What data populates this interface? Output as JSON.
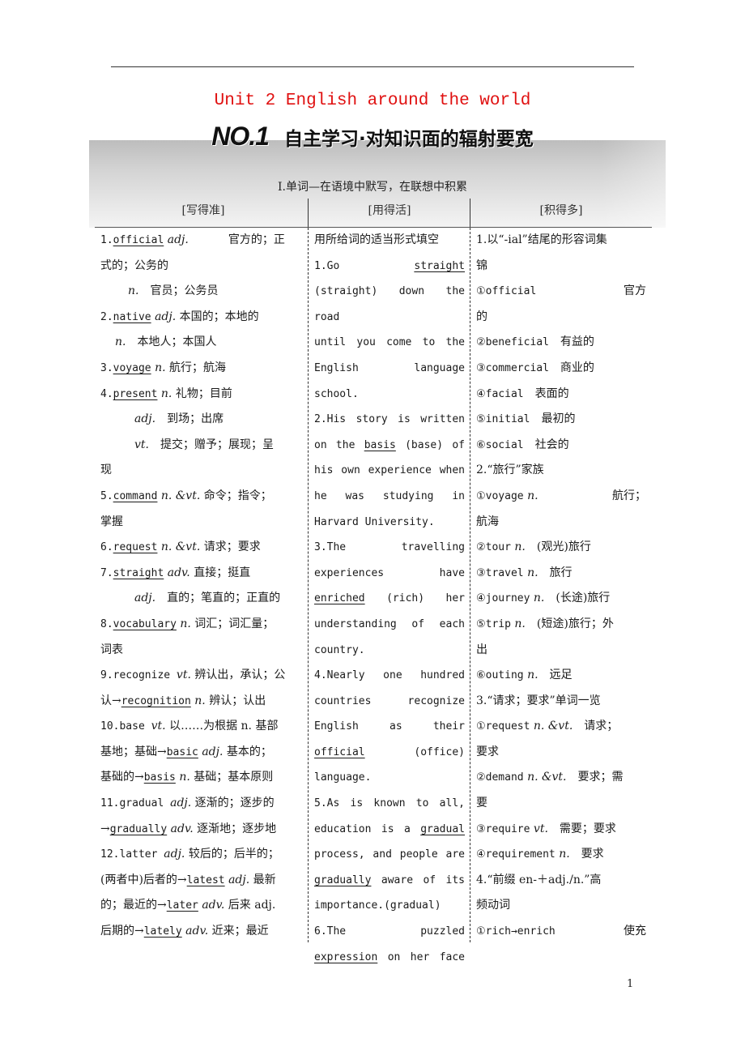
{
  "page": {
    "unit_title": "Unit 2  English around the world",
    "section_no": "NO.1",
    "section_title": "自主学习·对知识面的辐射要宽",
    "subheading": "Ⅰ.单词—在语境中默写，在联想中积累",
    "columns": [
      "[写得准]",
      "[用得活]",
      "[积得多]"
    ],
    "page_number": "1"
  },
  "left": [
    {
      "pre": "1.",
      "word": "official",
      "rest": "adj.",
      "tail": "官方的；正"
    },
    {
      "text": "式的；公务的"
    },
    {
      "pos": "n.",
      "tail": "官员；公务员"
    },
    {
      "pre": "2.",
      "word": "native",
      "rest": "adj.",
      "tail": "本国的；本地的"
    },
    {
      "pos": "n.",
      "tail": "本地人；本国人"
    },
    {
      "pre": "3.",
      "word": "voyage",
      "rest": "n.",
      "tail": "航行；航海"
    },
    {
      "pre": "4.",
      "word": "present",
      "rest": "n.",
      "tail": "礼物；目前"
    },
    {
      "pos": "adj.",
      "tail": "到场；出席"
    },
    {
      "pos": "vt.",
      "tail": "提交；赠予；展现；呈"
    },
    {
      "text": "现"
    },
    {
      "pre": "5.",
      "word": "command",
      "rest": "n. &vt.",
      "tail": "命令；指令；"
    },
    {
      "text": "掌握"
    },
    {
      "pre": "6.",
      "word": "request",
      "rest": "n. &vt.",
      "tail": "请求；要求"
    },
    {
      "pre": "7.",
      "word": "straight",
      "rest": "adv.",
      "tail": "直接；挺直"
    },
    {
      "pos": "adj.",
      "tail": "直的；笔直的；正直的"
    },
    {
      "pre": "8.",
      "word": "vocabulary",
      "rest": "n.",
      "tail": "词汇；词汇量；"
    },
    {
      "text": "词表"
    },
    {
      "pre": "9.recognize ",
      "rest": "vt.",
      "tail": "辨认出，承认；公"
    },
    {
      "lead": "认→",
      "word": "recognition",
      "rest": "n.",
      "tail": "辨认；认出"
    },
    {
      "pre": "10.base ",
      "rest": "vt.",
      "tail": "以……为根据 n. 基部"
    },
    {
      "lead": "基地；基础→",
      "word": "basic",
      "rest": "adj.",
      "tail": "基本的；"
    },
    {
      "lead": "基础的→",
      "word": "basis",
      "rest": "n.",
      "tail": "基础；基本原则"
    },
    {
      "pre": "11.gradual ",
      "rest": "adj.",
      "tail": "逐渐的；逐步的"
    },
    {
      "lead": "→",
      "word": "gradually",
      "rest": "adv.",
      "tail": "逐渐地；逐步地"
    },
    {
      "pre": "12.latter ",
      "rest": "adj.",
      "tail": "较后的；后半的；"
    },
    {
      "lead": "(两者中)后者的→",
      "word": "latest",
      "rest": "adj.",
      "tail": "最新"
    },
    {
      "lead": "的；最近的→",
      "word": "later",
      "rest": "adv.",
      "tail": "后来 adj."
    },
    {
      "lead": "后期的→",
      "word": "lately",
      "rest": "adv.",
      "tail": "近来；最近"
    }
  ],
  "middle": [
    {
      "text": "用所给词的适当形式填空",
      "zh": true
    },
    {
      "parts": [
        {
          "t": "1.Go"
        },
        {
          "t": "straight",
          "u": true
        }
      ],
      "just": true
    },
    {
      "parts": [
        {
          "t": "(straight) down the road"
        }
      ],
      "just": true
    },
    {
      "parts": [
        {
          "t": "until you come to the"
        }
      ],
      "just": true
    },
    {
      "parts": [
        {
          "t": "English language"
        }
      ],
      "just": true
    },
    {
      "parts": [
        {
          "t": "school."
        }
      ]
    },
    {
      "parts": [
        {
          "t": "2.His story is written"
        }
      ],
      "just": true
    },
    {
      "parts": [
        {
          "t": "on the "
        },
        {
          "t": "basis",
          "u": true
        },
        {
          "t": " (base)  of"
        }
      ],
      "just": true
    },
    {
      "parts": [
        {
          "t": "his own experience when"
        }
      ],
      "just": true
    },
    {
      "parts": [
        {
          "t": "he was studying in"
        }
      ],
      "just": true
    },
    {
      "parts": [
        {
          "t": "Harvard University."
        }
      ]
    },
    {
      "parts": [
        {
          "t": "3.The travelling"
        }
      ],
      "just": true
    },
    {
      "parts": [
        {
          "t": "experiences have"
        }
      ],
      "just": true
    },
    {
      "parts": [
        {
          "t": "enriched",
          "u": true
        },
        {
          "t": " (rich) her"
        }
      ],
      "just": true
    },
    {
      "parts": [
        {
          "t": "understanding of each"
        }
      ],
      "just": true
    },
    {
      "parts": [
        {
          "t": "country."
        }
      ]
    },
    {
      "parts": [
        {
          "t": "4.Nearly one hundred"
        }
      ],
      "just": true
    },
    {
      "parts": [
        {
          "t": "countries recognize"
        }
      ],
      "just": true
    },
    {
      "parts": [
        {
          "t": "English as their"
        }
      ],
      "just": true
    },
    {
      "parts": [
        {
          "t": "official",
          "u": true
        },
        {
          "t": " (office)"
        }
      ],
      "just": true
    },
    {
      "parts": [
        {
          "t": "language."
        }
      ]
    },
    {
      "parts": [
        {
          "t": "5.As is known to all,"
        }
      ],
      "just": true
    },
    {
      "parts": [
        {
          "t": "education is a "
        },
        {
          "t": "gradual",
          "u": true
        }
      ],
      "just": true
    },
    {
      "parts": [
        {
          "t": "process, and people are"
        }
      ],
      "just": true
    },
    {
      "parts": [
        {
          "t": "gradually",
          "u": true
        },
        {
          "t": " aware of its"
        }
      ],
      "just": true
    },
    {
      "parts": [
        {
          "t": "importance.(gradual)"
        }
      ]
    },
    {
      "parts": [
        {
          "t": "6.The puzzled"
        }
      ],
      "just": true
    },
    {
      "parts": [
        {
          "t": "expression",
          "u": true
        },
        {
          "t": " on her face"
        }
      ],
      "just": true
    }
  ],
  "right": [
    {
      "text": "1.以“-ial”结尾的形容词集"
    },
    {
      "text": "锦"
    },
    {
      "en": "①official",
      "tail": "官方",
      "split": true
    },
    {
      "text": "的"
    },
    {
      "en": "②beneficial",
      "tail": "有益的"
    },
    {
      "en": "③commercial",
      "tail": "商业的"
    },
    {
      "en": "④facial",
      "tail": "表面的"
    },
    {
      "en": "⑤initial",
      "tail": "最初的"
    },
    {
      "en": "⑥social",
      "tail": "社会的"
    },
    {
      "text": "2.“旅行”家族"
    },
    {
      "en": "①voyage",
      "pos": "n.",
      "tail": "航行；",
      "split": true
    },
    {
      "text": "航海"
    },
    {
      "en": "②tour",
      "pos": "n.",
      "tail": "(观光)旅行"
    },
    {
      "en": "③travel",
      "pos": "n.",
      "tail": "旅行"
    },
    {
      "en": "④journey",
      "pos": "n.",
      "tail": "(长途)旅行"
    },
    {
      "en": "⑤trip",
      "pos": "n.",
      "tail": "(短途)旅行；外"
    },
    {
      "text": "出"
    },
    {
      "en": "⑥outing",
      "pos": "n.",
      "tail": "远足"
    },
    {
      "text": "3.“请求；要求”单词一览"
    },
    {
      "en": "①request",
      "pos": "n. &vt.",
      "tail": "请求；"
    },
    {
      "text": "要求"
    },
    {
      "en": "②demand",
      "pos": "n. &vt.",
      "tail": "要求；需"
    },
    {
      "text": "要"
    },
    {
      "en": "③require",
      "pos": "vt.",
      "tail": "需要；要求"
    },
    {
      "en": "④requirement",
      "pos": "n.",
      "tail": "要求"
    },
    {
      "text": "4.“前缀 en-＋adj./n.”高"
    },
    {
      "text": "频动词"
    },
    {
      "en": "①rich→enrich",
      "tail": "使充",
      "split": true
    }
  ]
}
